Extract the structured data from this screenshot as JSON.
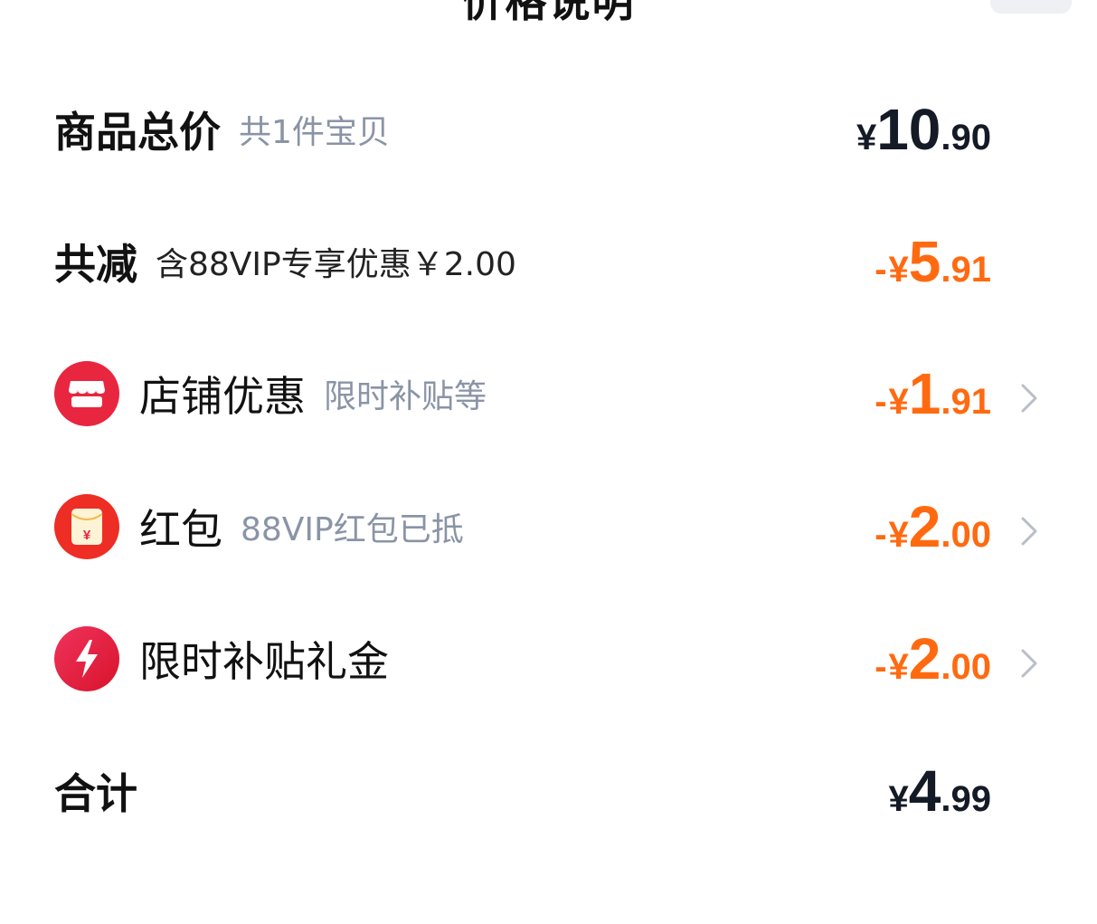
{
  "header": {
    "title": "价格说明"
  },
  "rows": {
    "total": {
      "label": "商品总价",
      "sub": "共1件宝贝",
      "price": {
        "yen": "¥",
        "int": "10",
        "dot": ".",
        "dec": "90"
      }
    },
    "discount": {
      "label": "共减",
      "sub": "含88VIP专享优惠￥2.00",
      "price": {
        "sign": "-",
        "yen": "¥",
        "int": "5",
        "dot": ".",
        "dec": "91"
      }
    },
    "shop": {
      "label": "店铺优惠",
      "sub": "限时补贴等",
      "icon": "storefront-icon",
      "price": {
        "sign": "-",
        "yen": "¥",
        "int": "1",
        "dot": ".",
        "dec": "91"
      }
    },
    "redpacket": {
      "label": "红包",
      "sub": "88VIP红包已抵",
      "icon": "red-packet-icon",
      "icon_glyph": "¥",
      "price": {
        "sign": "-",
        "yen": "¥",
        "int": "2",
        "dot": ".",
        "dec": "00"
      }
    },
    "subsidy": {
      "label": "限时补贴礼金",
      "icon": "lightning-icon",
      "price": {
        "sign": "-",
        "yen": "¥",
        "int": "2",
        "dot": ".",
        "dec": "00"
      }
    },
    "sum": {
      "label": "合计",
      "price": {
        "yen": "¥",
        "int": "4",
        "dot": ".",
        "dec": "99"
      }
    }
  },
  "colors": {
    "accent_orange": "#ff6a10",
    "text_dark": "#111111",
    "text_muted": "#8a94a6",
    "icon_red": "#e8263f"
  }
}
